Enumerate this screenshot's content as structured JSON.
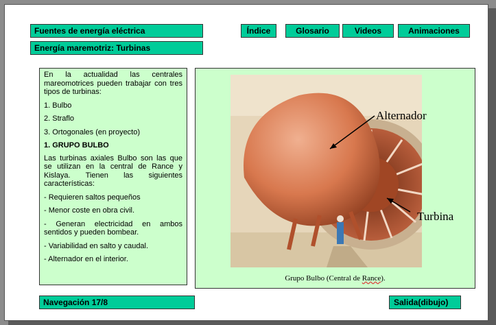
{
  "header": {
    "topic": "Fuentes de energía eléctrica",
    "subtopic": "Energía maremotriz: Turbinas"
  },
  "nav": {
    "indice": "Índice",
    "glosario": "Glosario",
    "videos": "Videos",
    "animaciones": "Animaciones"
  },
  "text_panel": {
    "intro": "En la actualidad las centrales mareomotrices pueden trabajar con tres tipos de turbinas:",
    "items": [
      "1. Bulbo",
      "2. Straflo",
      "3. Ortogonales (en proyecto)"
    ],
    "heading": "1. GRUPO BULBO",
    "description": "Las turbinas axiales Bulbo son las que se utilizan en la central de Rance y Kislaya. Tienen las siguientes características:",
    "features": [
      "- Requieren saltos pequeños",
      "- Menor coste en obra civil.",
      "- Generan electricidad en ambos sentidos y pueden bombear.",
      "- Variabilidad en salto y caudal.",
      "- Alternador en el interior."
    ]
  },
  "figure": {
    "caption_pre": "Grupo Bulbo (Central de ",
    "caption_word": "Rance",
    "caption_post": ").",
    "label_alternador": "Alternador",
    "label_turbina": "Turbina"
  },
  "footer": {
    "navigation": "Navegación 17/8",
    "exit": "Salida(dibujo)"
  },
  "colors": {
    "teal": "#00cc99",
    "panel": "#ccffcc"
  }
}
